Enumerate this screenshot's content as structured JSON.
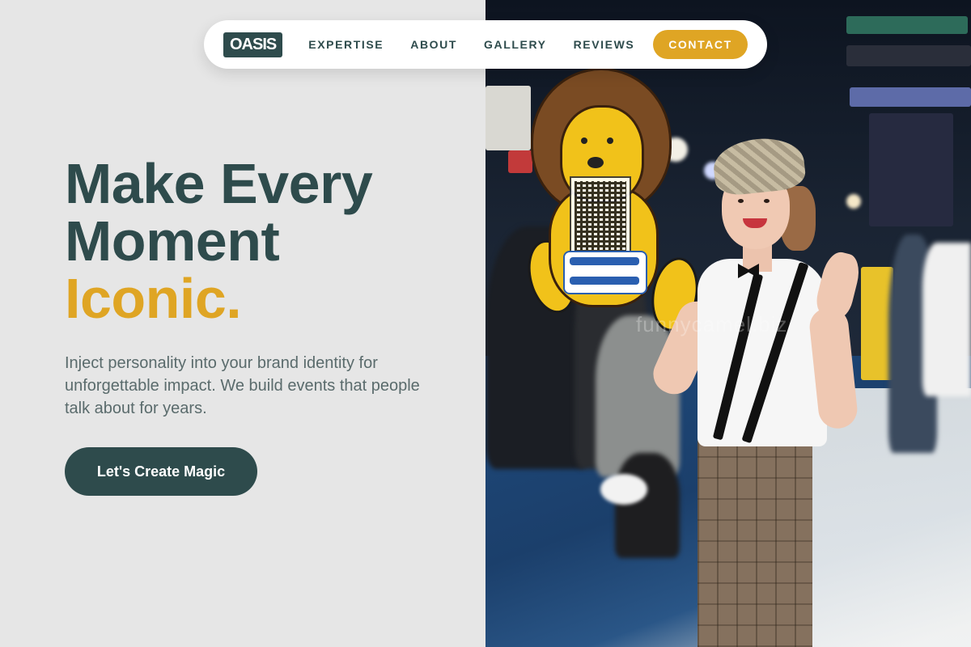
{
  "nav": {
    "logo": "OASIS",
    "links": [
      {
        "label": "EXPERTISE"
      },
      {
        "label": "ABOUT"
      },
      {
        "label": "GALLERY"
      },
      {
        "label": "REVIEWS"
      }
    ],
    "contact_label": "CONTACT"
  },
  "hero": {
    "headline_line1": "Make Every",
    "headline_line2": "Moment",
    "headline_accent": "Iconic.",
    "subtitle": "Inject personality into your brand identity for unforgettable impact. We build events that people talk about for years.",
    "cta_label": "Let's Create Magic"
  },
  "photo": {
    "watermark": "funnycamel.biz"
  },
  "colors": {
    "primary": "#2e4b4c",
    "accent": "#dfa524",
    "background": "#e6e6e6",
    "text_muted": "#5a6b6c"
  }
}
